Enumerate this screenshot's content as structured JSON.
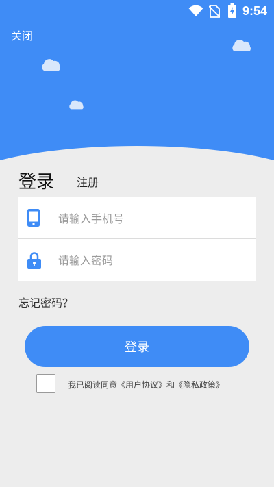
{
  "status_bar": {
    "time": "9:54"
  },
  "header": {
    "close_label": "关闭"
  },
  "tabs": {
    "login_label": "登录",
    "register_label": "注册"
  },
  "form": {
    "phone_placeholder": "请输入手机号",
    "password_placeholder": "请输入密码"
  },
  "links": {
    "forgot_password": "忘记密码？"
  },
  "actions": {
    "login_button": "登录"
  },
  "agreement": {
    "text": "我已阅读同意《用户协议》和《隐私政策》",
    "checked": false
  },
  "colors": {
    "primary": "#3f8cf6",
    "background": "#ededed"
  },
  "icons": {
    "phone_field": "phone-icon",
    "password_field": "lock-icon"
  }
}
